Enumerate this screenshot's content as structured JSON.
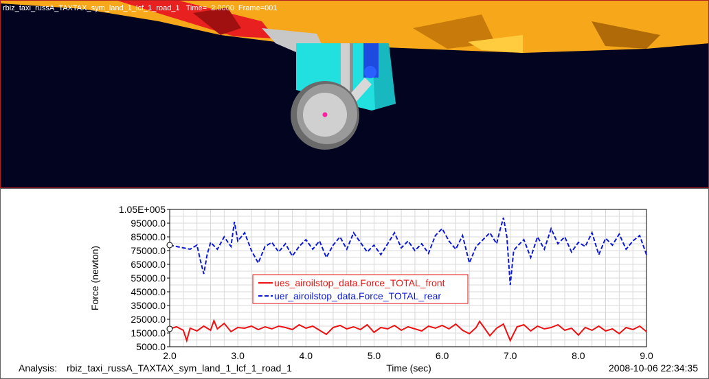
{
  "viewport": {
    "title": "rbiz_taxi_russA_TAXTAX_sym_land_1_lcf_1_road_1   Time=  2.0000  Frame=001",
    "colors": {
      "background": "#030420",
      "wing": "#f6a81a",
      "flap": "#e82020",
      "strut": "#22e0e0",
      "tire": "#9a9a9a",
      "piston": "#1d4be0",
      "hub_marker": "#ff20a0"
    }
  },
  "footer": {
    "analysis_label": "Analysis:",
    "analysis_name": "rbiz_taxi_russA_TAXTAX_sym_land_1_lcf_1_road_1",
    "timestamp": "2008-10-06 22:34:35"
  },
  "chart_data": {
    "type": "line",
    "xlabel": "Time (sec)",
    "ylabel": "Force (newton)",
    "xlim": [
      2.0,
      9.0
    ],
    "ylim": [
      5000.0,
      105000.0
    ],
    "x_ticks": [
      "2.0",
      "3.0",
      "4.0",
      "5.0",
      "6.0",
      "7.0",
      "8.0",
      "9.0"
    ],
    "y_ticks": [
      "1.05E+005",
      "95000.0",
      "85000.0",
      "75000.0",
      "65000.0",
      "55000.0",
      "45000.0",
      "35000.0",
      "25000.0",
      "15000.0",
      "5000.0"
    ],
    "grid": true,
    "legend_placement": "center-left",
    "series": [
      {
        "name": "ues_airoilstop_data.Force_TOTAL_front",
        "color": "#ee1111",
        "style": "solid",
        "x": [
          2.0,
          2.1,
          2.2,
          2.25,
          2.3,
          2.4,
          2.5,
          2.6,
          2.65,
          2.7,
          2.8,
          2.9,
          3.0,
          3.1,
          3.2,
          3.3,
          3.4,
          3.5,
          3.6,
          3.7,
          3.8,
          3.9,
          4.0,
          4.1,
          4.2,
          4.3,
          4.4,
          4.5,
          4.6,
          4.7,
          4.8,
          4.9,
          5.0,
          5.1,
          5.2,
          5.3,
          5.4,
          5.5,
          5.6,
          5.7,
          5.8,
          5.9,
          6.0,
          6.1,
          6.2,
          6.3,
          6.4,
          6.5,
          6.55,
          6.6,
          6.7,
          6.8,
          6.9,
          7.0,
          7.1,
          7.2,
          7.3,
          7.4,
          7.5,
          7.6,
          7.7,
          7.8,
          7.9,
          8.0,
          8.1,
          8.2,
          8.3,
          8.4,
          8.5,
          8.6,
          8.7,
          8.8,
          8.9,
          9.0
        ],
        "y": [
          18000,
          19500,
          17000,
          9500,
          18500,
          16500,
          20000,
          17000,
          24000,
          18000,
          22000,
          16000,
          19000,
          18500,
          20000,
          17500,
          19500,
          18000,
          20000,
          19000,
          17500,
          21000,
          18500,
          20000,
          17000,
          14000,
          19000,
          20500,
          18000,
          19500,
          17500,
          21000,
          15500,
          19000,
          18000,
          20500,
          17000,
          19500,
          18000,
          16500,
          20000,
          18500,
          20500,
          18000,
          21500,
          17000,
          14500,
          19000,
          23500,
          20000,
          13000,
          18500,
          21500,
          9500,
          19500,
          21000,
          16500,
          20000,
          18000,
          19000,
          21000,
          17000,
          18500,
          13500,
          19000,
          17000,
          20000,
          16500,
          18000,
          14500,
          19000,
          17500,
          20000,
          16000
        ]
      },
      {
        "name": "uer_airoilstop_data.Force_TOTAL_rear",
        "color": "#0b18d8",
        "style": "dashed",
        "x": [
          2.0,
          2.1,
          2.2,
          2.3,
          2.4,
          2.45,
          2.5,
          2.55,
          2.6,
          2.7,
          2.8,
          2.9,
          2.95,
          3.0,
          3.1,
          3.2,
          3.3,
          3.4,
          3.5,
          3.6,
          3.7,
          3.8,
          3.9,
          4.0,
          4.1,
          4.2,
          4.3,
          4.4,
          4.5,
          4.6,
          4.7,
          4.8,
          4.9,
          5.0,
          5.1,
          5.2,
          5.3,
          5.4,
          5.5,
          5.6,
          5.7,
          5.8,
          5.9,
          6.0,
          6.1,
          6.2,
          6.3,
          6.4,
          6.5,
          6.6,
          6.7,
          6.8,
          6.85,
          6.9,
          6.95,
          7.0,
          7.05,
          7.1,
          7.2,
          7.3,
          7.4,
          7.5,
          7.6,
          7.7,
          7.8,
          7.9,
          8.0,
          8.1,
          8.2,
          8.3,
          8.4,
          8.5,
          8.6,
          8.7,
          8.8,
          8.9,
          9.0
        ],
        "y": [
          79000,
          78000,
          77000,
          76000,
          79000,
          68000,
          58000,
          72000,
          81000,
          76000,
          85000,
          78000,
          96000,
          82000,
          88000,
          75000,
          66000,
          78000,
          81000,
          74000,
          80000,
          71000,
          78000,
          83000,
          76000,
          82000,
          70000,
          79000,
          85000,
          76000,
          88000,
          81000,
          74000,
          79000,
          72000,
          80000,
          88000,
          77000,
          82000,
          75000,
          80000,
          73000,
          86000,
          91000,
          82000,
          76000,
          86000,
          66000,
          78000,
          83000,
          88000,
          80000,
          90000,
          99000,
          85000,
          50000,
          75000,
          78000,
          83000,
          70000,
          85000,
          76000,
          91000,
          80000,
          85000,
          74000,
          81000,
          78000,
          88000,
          72000,
          84000,
          79000,
          87000,
          76000,
          82000,
          86000,
          72000
        ]
      }
    ]
  }
}
